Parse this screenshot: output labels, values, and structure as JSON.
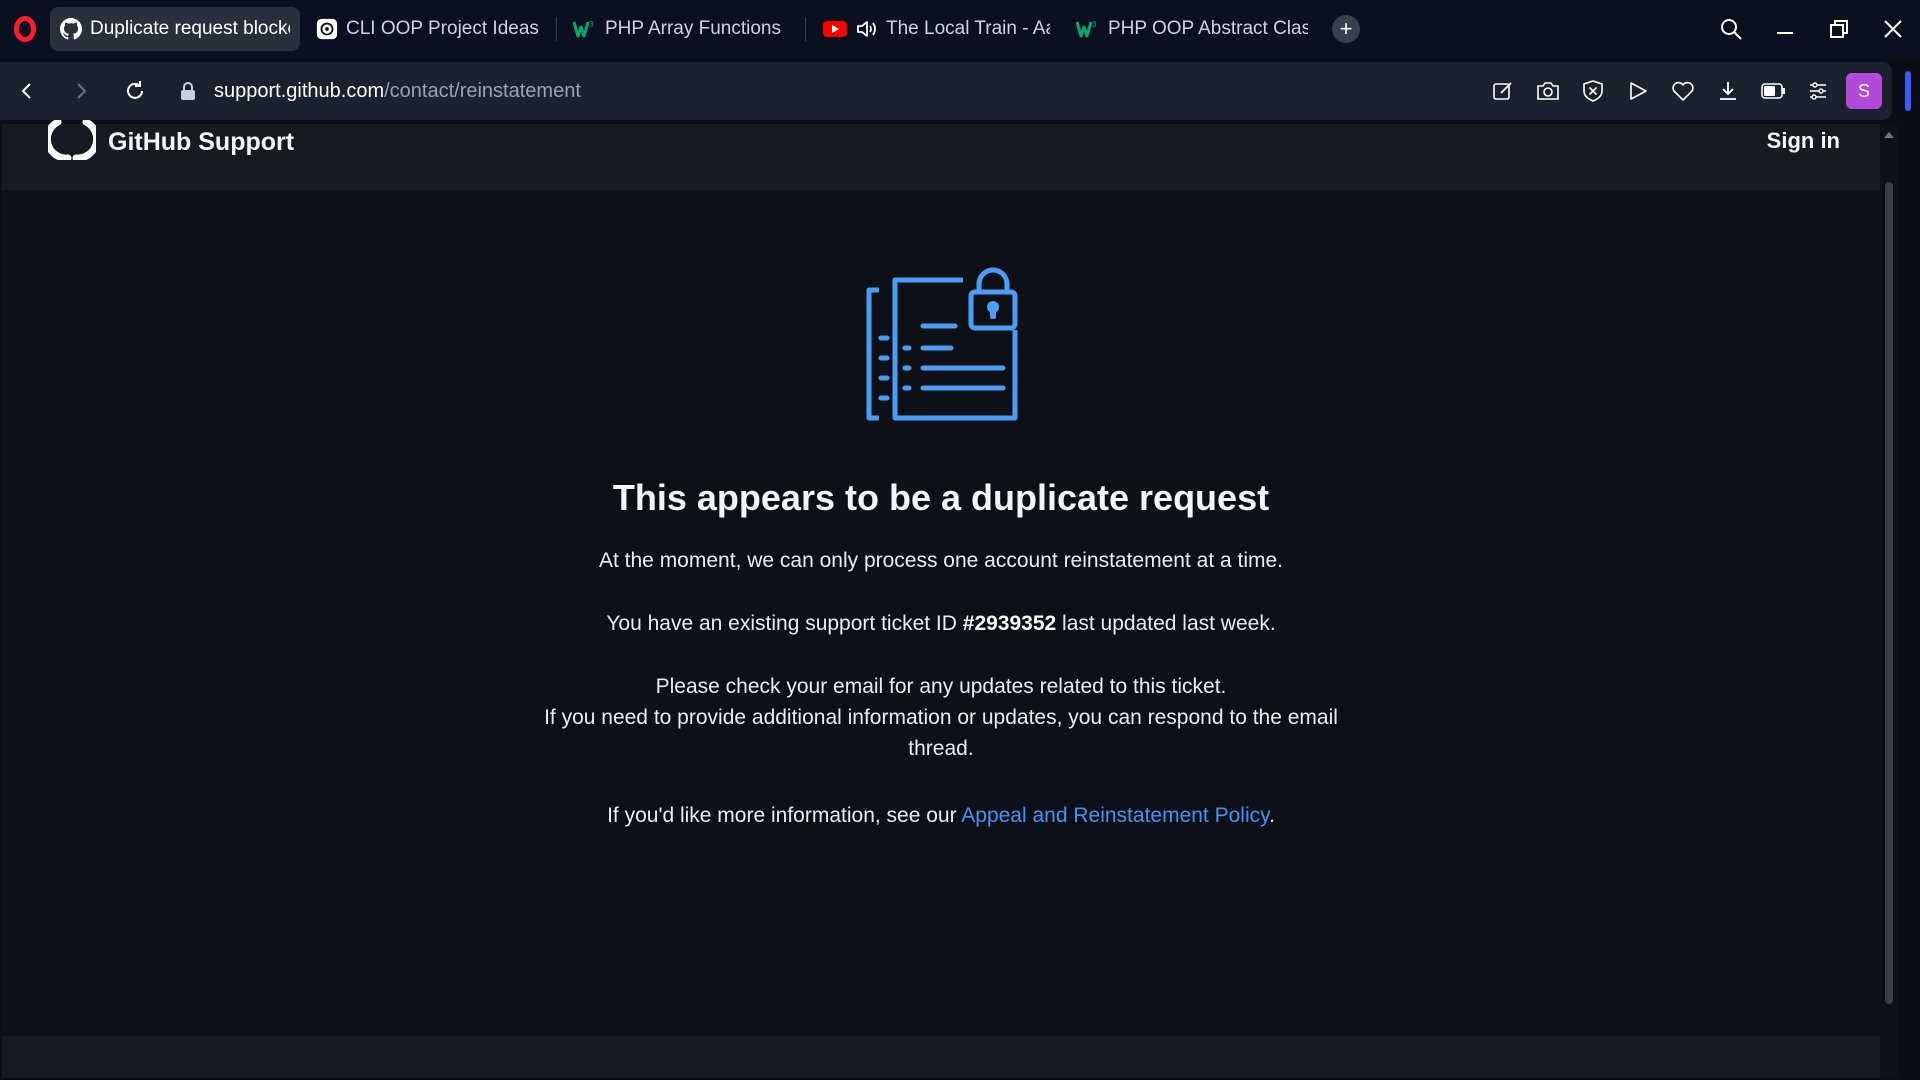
{
  "browser": {
    "tabs": [
      {
        "label": "Duplicate request blocked",
        "favicon": "github-icon",
        "active": true
      },
      {
        "label": "CLI OOP Project Ideas",
        "favicon": "openai-icon",
        "active": false
      },
      {
        "label": "PHP Array Functions",
        "favicon": "w3schools-icon",
        "active": false
      },
      {
        "label": "The Local Train - Aaog",
        "favicon": "youtube-icon",
        "active": false
      },
      {
        "label": "PHP OOP Abstract Classes",
        "favicon": "w3schools-icon",
        "active": false
      }
    ],
    "new_tab": "+",
    "url_host": "support.github.com",
    "url_path": "/contact/reinstatement",
    "profile_initial": "S"
  },
  "site": {
    "brand": "GitHub Support",
    "sign_in": "Sign in"
  },
  "message": {
    "title": "This appears to be a duplicate request",
    "line1": "At the moment, we can only process one account reinstatement at a time.",
    "line2_prefix": "You have an existing support ticket ID ",
    "ticket_id": "#2939352",
    "line2_suffix": " last updated last week.",
    "line3": "Please check your email for any updates related to this ticket.",
    "line4": "If you need to provide additional information or updates, you can respond to the email thread.",
    "line5_prefix": "If you'd like more information, see our ",
    "policy_link": "Appeal and Reinstatement Policy",
    "line5_suffix": "."
  },
  "colors": {
    "accent_link": "#4493f8",
    "illustration": "#4a9ef5",
    "page_bg": "#0d1117",
    "header_bg": "#161b22",
    "opera_red": "#ff1b2d",
    "profile_purple": "#b04ad9"
  }
}
